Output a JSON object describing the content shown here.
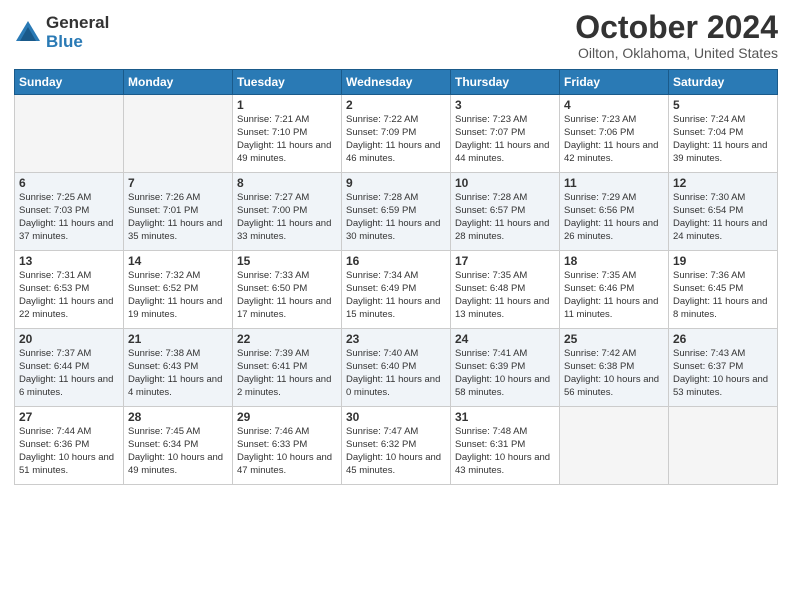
{
  "logo": {
    "general": "General",
    "blue": "Blue"
  },
  "header": {
    "month": "October 2024",
    "location": "Oilton, Oklahoma, United States"
  },
  "weekdays": [
    "Sunday",
    "Monday",
    "Tuesday",
    "Wednesday",
    "Thursday",
    "Friday",
    "Saturday"
  ],
  "weeks": [
    [
      {
        "day": "",
        "sunrise": "",
        "sunset": "",
        "daylight": ""
      },
      {
        "day": "",
        "sunrise": "",
        "sunset": "",
        "daylight": ""
      },
      {
        "day": "1",
        "sunrise": "Sunrise: 7:21 AM",
        "sunset": "Sunset: 7:10 PM",
        "daylight": "Daylight: 11 hours and 49 minutes."
      },
      {
        "day": "2",
        "sunrise": "Sunrise: 7:22 AM",
        "sunset": "Sunset: 7:09 PM",
        "daylight": "Daylight: 11 hours and 46 minutes."
      },
      {
        "day": "3",
        "sunrise": "Sunrise: 7:23 AM",
        "sunset": "Sunset: 7:07 PM",
        "daylight": "Daylight: 11 hours and 44 minutes."
      },
      {
        "day": "4",
        "sunrise": "Sunrise: 7:23 AM",
        "sunset": "Sunset: 7:06 PM",
        "daylight": "Daylight: 11 hours and 42 minutes."
      },
      {
        "day": "5",
        "sunrise": "Sunrise: 7:24 AM",
        "sunset": "Sunset: 7:04 PM",
        "daylight": "Daylight: 11 hours and 39 minutes."
      }
    ],
    [
      {
        "day": "6",
        "sunrise": "Sunrise: 7:25 AM",
        "sunset": "Sunset: 7:03 PM",
        "daylight": "Daylight: 11 hours and 37 minutes."
      },
      {
        "day": "7",
        "sunrise": "Sunrise: 7:26 AM",
        "sunset": "Sunset: 7:01 PM",
        "daylight": "Daylight: 11 hours and 35 minutes."
      },
      {
        "day": "8",
        "sunrise": "Sunrise: 7:27 AM",
        "sunset": "Sunset: 7:00 PM",
        "daylight": "Daylight: 11 hours and 33 minutes."
      },
      {
        "day": "9",
        "sunrise": "Sunrise: 7:28 AM",
        "sunset": "Sunset: 6:59 PM",
        "daylight": "Daylight: 11 hours and 30 minutes."
      },
      {
        "day": "10",
        "sunrise": "Sunrise: 7:28 AM",
        "sunset": "Sunset: 6:57 PM",
        "daylight": "Daylight: 11 hours and 28 minutes."
      },
      {
        "day": "11",
        "sunrise": "Sunrise: 7:29 AM",
        "sunset": "Sunset: 6:56 PM",
        "daylight": "Daylight: 11 hours and 26 minutes."
      },
      {
        "day": "12",
        "sunrise": "Sunrise: 7:30 AM",
        "sunset": "Sunset: 6:54 PM",
        "daylight": "Daylight: 11 hours and 24 minutes."
      }
    ],
    [
      {
        "day": "13",
        "sunrise": "Sunrise: 7:31 AM",
        "sunset": "Sunset: 6:53 PM",
        "daylight": "Daylight: 11 hours and 22 minutes."
      },
      {
        "day": "14",
        "sunrise": "Sunrise: 7:32 AM",
        "sunset": "Sunset: 6:52 PM",
        "daylight": "Daylight: 11 hours and 19 minutes."
      },
      {
        "day": "15",
        "sunrise": "Sunrise: 7:33 AM",
        "sunset": "Sunset: 6:50 PM",
        "daylight": "Daylight: 11 hours and 17 minutes."
      },
      {
        "day": "16",
        "sunrise": "Sunrise: 7:34 AM",
        "sunset": "Sunset: 6:49 PM",
        "daylight": "Daylight: 11 hours and 15 minutes."
      },
      {
        "day": "17",
        "sunrise": "Sunrise: 7:35 AM",
        "sunset": "Sunset: 6:48 PM",
        "daylight": "Daylight: 11 hours and 13 minutes."
      },
      {
        "day": "18",
        "sunrise": "Sunrise: 7:35 AM",
        "sunset": "Sunset: 6:46 PM",
        "daylight": "Daylight: 11 hours and 11 minutes."
      },
      {
        "day": "19",
        "sunrise": "Sunrise: 7:36 AM",
        "sunset": "Sunset: 6:45 PM",
        "daylight": "Daylight: 11 hours and 8 minutes."
      }
    ],
    [
      {
        "day": "20",
        "sunrise": "Sunrise: 7:37 AM",
        "sunset": "Sunset: 6:44 PM",
        "daylight": "Daylight: 11 hours and 6 minutes."
      },
      {
        "day": "21",
        "sunrise": "Sunrise: 7:38 AM",
        "sunset": "Sunset: 6:43 PM",
        "daylight": "Daylight: 11 hours and 4 minutes."
      },
      {
        "day": "22",
        "sunrise": "Sunrise: 7:39 AM",
        "sunset": "Sunset: 6:41 PM",
        "daylight": "Daylight: 11 hours and 2 minutes."
      },
      {
        "day": "23",
        "sunrise": "Sunrise: 7:40 AM",
        "sunset": "Sunset: 6:40 PM",
        "daylight": "Daylight: 11 hours and 0 minutes."
      },
      {
        "day": "24",
        "sunrise": "Sunrise: 7:41 AM",
        "sunset": "Sunset: 6:39 PM",
        "daylight": "Daylight: 10 hours and 58 minutes."
      },
      {
        "day": "25",
        "sunrise": "Sunrise: 7:42 AM",
        "sunset": "Sunset: 6:38 PM",
        "daylight": "Daylight: 10 hours and 56 minutes."
      },
      {
        "day": "26",
        "sunrise": "Sunrise: 7:43 AM",
        "sunset": "Sunset: 6:37 PM",
        "daylight": "Daylight: 10 hours and 53 minutes."
      }
    ],
    [
      {
        "day": "27",
        "sunrise": "Sunrise: 7:44 AM",
        "sunset": "Sunset: 6:36 PM",
        "daylight": "Daylight: 10 hours and 51 minutes."
      },
      {
        "day": "28",
        "sunrise": "Sunrise: 7:45 AM",
        "sunset": "Sunset: 6:34 PM",
        "daylight": "Daylight: 10 hours and 49 minutes."
      },
      {
        "day": "29",
        "sunrise": "Sunrise: 7:46 AM",
        "sunset": "Sunset: 6:33 PM",
        "daylight": "Daylight: 10 hours and 47 minutes."
      },
      {
        "day": "30",
        "sunrise": "Sunrise: 7:47 AM",
        "sunset": "Sunset: 6:32 PM",
        "daylight": "Daylight: 10 hours and 45 minutes."
      },
      {
        "day": "31",
        "sunrise": "Sunrise: 7:48 AM",
        "sunset": "Sunset: 6:31 PM",
        "daylight": "Daylight: 10 hours and 43 minutes."
      },
      {
        "day": "",
        "sunrise": "",
        "sunset": "",
        "daylight": ""
      },
      {
        "day": "",
        "sunrise": "",
        "sunset": "",
        "daylight": ""
      }
    ]
  ]
}
